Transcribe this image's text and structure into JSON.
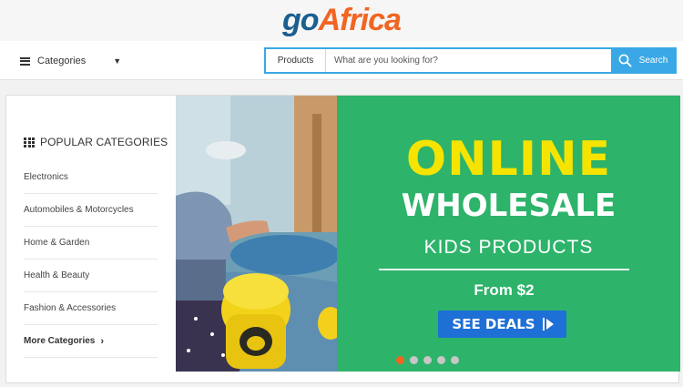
{
  "brand": {
    "part1": "go",
    "part2": "Africa"
  },
  "nav": {
    "categories_label": "Categories",
    "search": {
      "scope": "Products",
      "placeholder": "What are you looking for?",
      "button_label": "Search"
    }
  },
  "sidebar": {
    "title": "POPULAR CATEGORIES",
    "items": [
      {
        "label": "Electronics"
      },
      {
        "label": "Automobiles & Motorcycles"
      },
      {
        "label": "Home & Garden"
      },
      {
        "label": "Health & Beauty"
      },
      {
        "label": "Fashion & Accessories"
      }
    ],
    "more_label": "More Categories"
  },
  "banner": {
    "headline1": "ONLINE",
    "headline2": "WHOLESALE",
    "subtitle": "KIDS PRODUCTS",
    "price": "From $2",
    "cta": "SEE DEALS",
    "slides_total": 5,
    "active_slide": 1
  },
  "colors": {
    "brand_blue": "#1a5f8f",
    "brand_orange": "#f26522",
    "search_blue": "#3aa8e6",
    "banner_green": "#2db36a",
    "headline_yellow": "#f6e400",
    "cta_blue": "#1e6fd6"
  }
}
